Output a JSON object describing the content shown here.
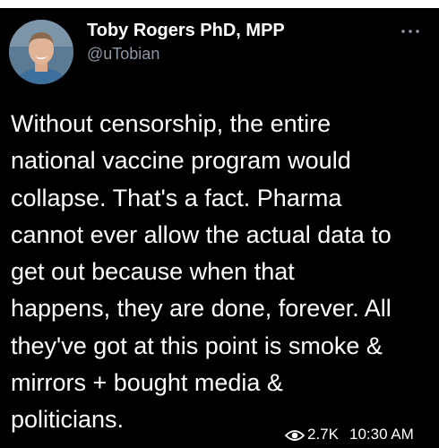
{
  "author": {
    "display_name": "Toby Rogers PhD, MPP",
    "handle": "@uTobian"
  },
  "tweet": {
    "lines": [
      "Without censorship, the entire",
      "national vaccine program would",
      "collapse. That's a fact. Pharma",
      "cannot ever allow the actual data to",
      "get out because when that",
      "happens, they are done, forever. All",
      "they've got at this point is smoke &",
      "mirrors + bought media &",
      "politicians."
    ]
  },
  "meta": {
    "views": "2.7K",
    "time": "10:30 AM"
  },
  "icons": {
    "more": "more-options-icon",
    "views": "eye-icon"
  },
  "colors": {
    "background": "#000000",
    "text": "#ffffff",
    "secondary_text": "#8b98a5"
  }
}
